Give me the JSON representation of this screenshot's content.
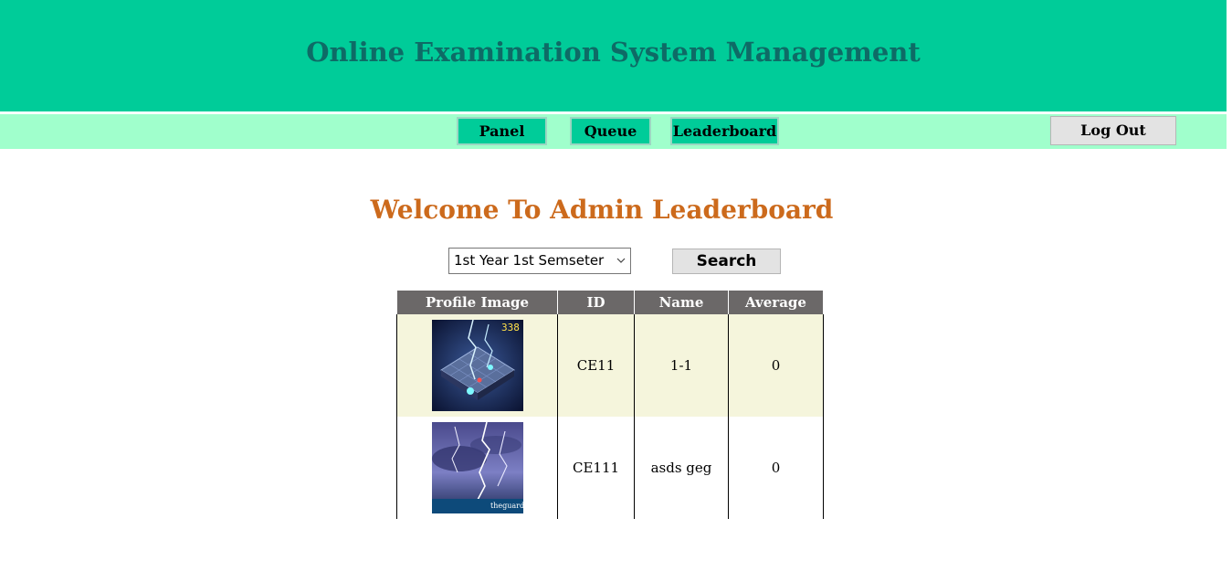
{
  "header": {
    "title": "Online Examination System Management"
  },
  "nav": {
    "items": [
      {
        "label": "Panel"
      },
      {
        "label": "Queue"
      },
      {
        "label": "Leaderboard"
      }
    ],
    "logout_label": "Log Out"
  },
  "main": {
    "heading": "Welcome To Admin Leaderboard",
    "semester_select": {
      "selected": "1st Year 1st Semseter"
    },
    "search_label": "Search"
  },
  "table": {
    "headers": [
      "Profile Image",
      "ID",
      "Name",
      "Average"
    ],
    "rows": [
      {
        "image_icon": "game-screenshot-image",
        "image_text": "338",
        "id": "CE11",
        "name": "1-1",
        "average": "0"
      },
      {
        "image_icon": "lightning-storm-image",
        "image_text": "theguardian",
        "id": "CE111",
        "name": "asds geg",
        "average": "0"
      }
    ]
  },
  "colors": {
    "header_bg": "#00cc99",
    "header_title": "#0e6b66",
    "nav_bg": "#a0ffcc",
    "welcome": "#cc6a1c",
    "table_header_bg": "#6b6868",
    "row_highlight": "#f5f5dc"
  }
}
